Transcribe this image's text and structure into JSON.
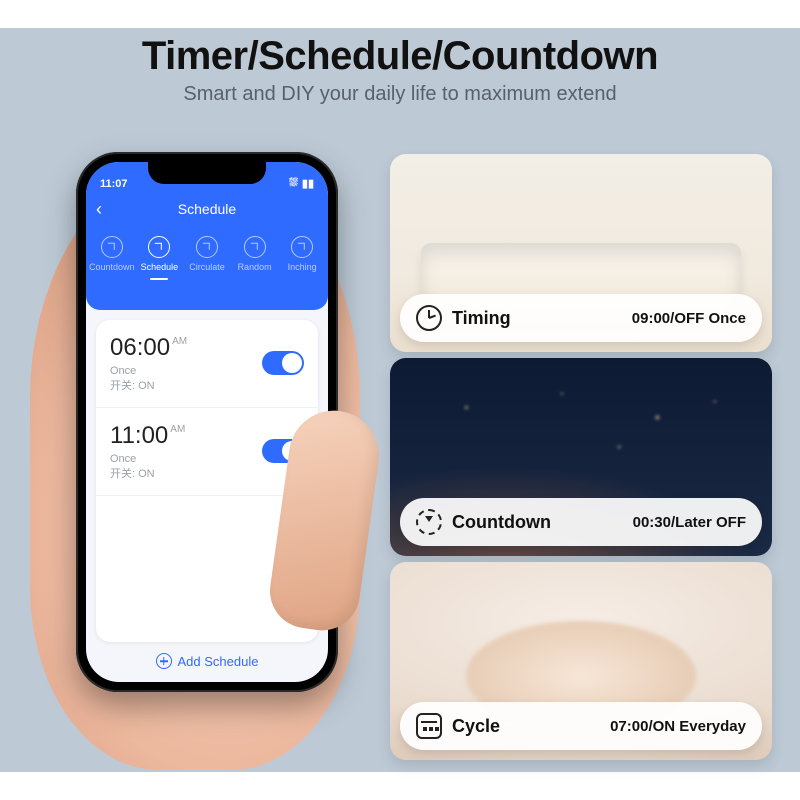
{
  "headline": {
    "title": "Timer/Schedule/Countdown",
    "subtitle": "Smart and DIY your daily life to maximum extend"
  },
  "phone": {
    "status_time": "11:07",
    "header": {
      "title": "Schedule"
    },
    "tabs": [
      {
        "label": "Countdown",
        "active": false
      },
      {
        "label": "Schedule",
        "active": true
      },
      {
        "label": "Circulate",
        "active": false
      },
      {
        "label": "Random",
        "active": false
      },
      {
        "label": "Inching",
        "active": false
      }
    ],
    "schedules": [
      {
        "time": "06:00",
        "ampm": "AM",
        "repeat": "Once",
        "state_label": "开关: ON",
        "enabled": true
      },
      {
        "time": "11:00",
        "ampm": "AM",
        "repeat": "Once",
        "state_label": "开关: ON",
        "enabled": true
      }
    ],
    "add_label": "Add Schedule"
  },
  "cards": [
    {
      "icon": "clock",
      "title": "Timing",
      "value": "09:00/OFF Once"
    },
    {
      "icon": "countdown",
      "title": "Countdown",
      "value": "00:30/Later OFF"
    },
    {
      "icon": "cal",
      "title": "Cycle",
      "value": "07:00/ON Everyday"
    }
  ]
}
